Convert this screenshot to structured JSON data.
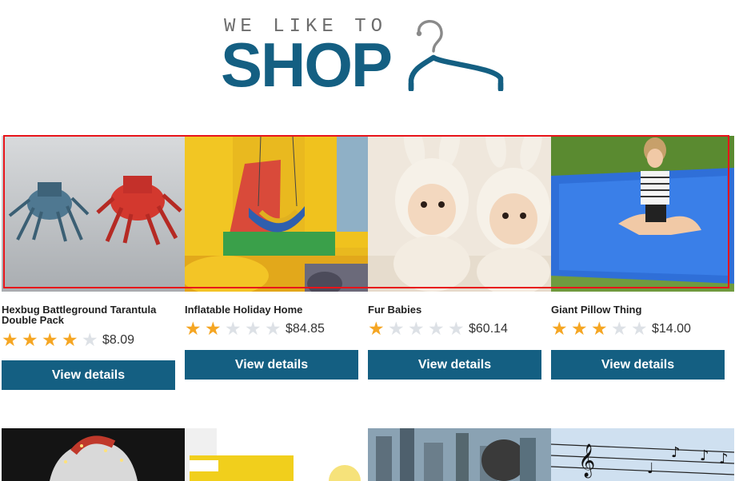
{
  "brand": {
    "tagline": "WE LIKE TO",
    "wordmark": "SHOP",
    "color": "#145f82",
    "icon": "hanger-icon"
  },
  "products": [
    {
      "title": "Hexbug Battleground Tarantula Double Pack",
      "rating": 4,
      "max_rating": 5,
      "price": "$8.09",
      "button": "View details",
      "image": "robot-spiders-image"
    },
    {
      "title": "Inflatable Holiday Home",
      "rating": 2,
      "max_rating": 5,
      "price": "$84.85",
      "button": "View details",
      "image": "bouncy-castle-image"
    },
    {
      "title": "Fur Babies",
      "rating": 1,
      "max_rating": 5,
      "price": "$60.14",
      "button": "View details",
      "image": "babies-in-bunny-suits-image"
    },
    {
      "title": "Giant Pillow Thing",
      "rating": 3,
      "max_rating": 5,
      "price": "$14.00",
      "button": "View details",
      "image": "giant-blue-pillow-image"
    }
  ],
  "second_row_images": [
    "santa-hat-image",
    "ridleys-box-image",
    "city-skyline-image",
    "music-notes-wire-image"
  ],
  "colors": {
    "star_on": "#f5a623",
    "star_off": "#dde1e6",
    "button_bg": "#145f82",
    "selection_outline": "#e8141a"
  }
}
